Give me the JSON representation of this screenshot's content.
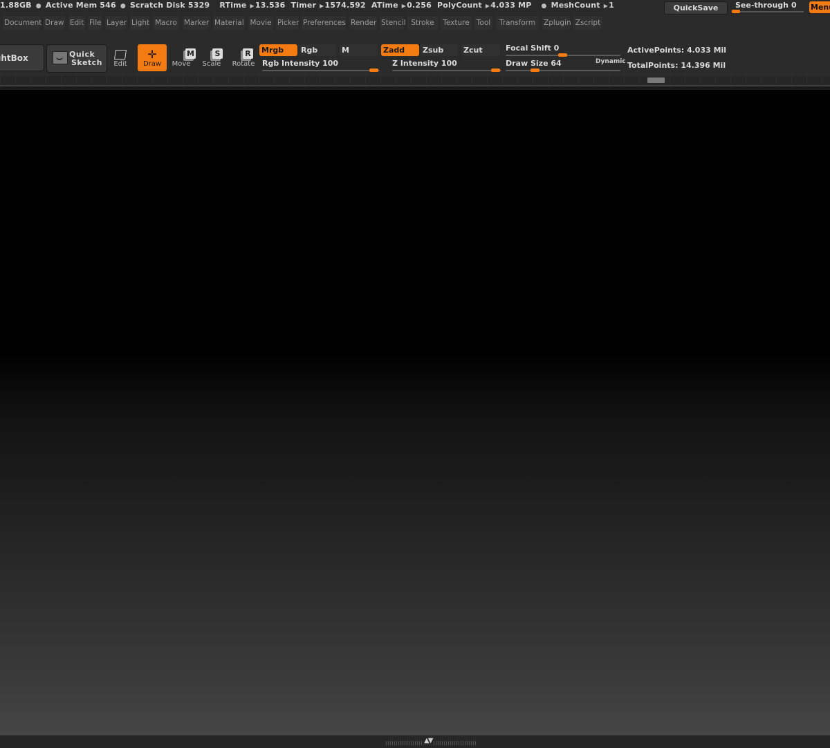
{
  "status": {
    "items": [
      {
        "text": "1.88GB"
      },
      {
        "text": "Active Mem 546"
      },
      {
        "text": "Scratch Disk 5329"
      },
      {
        "text": "RTime",
        "value": "13.536"
      },
      {
        "text": "Timer",
        "value": "1574.592"
      },
      {
        "text": "ATime",
        "value": "0.256"
      },
      {
        "text": "PolyCount",
        "value": "4.033  MP"
      },
      {
        "text": "MeshCount",
        "value": "1"
      }
    ],
    "quicksave_label": "QuickSave",
    "seethrough_label": "See-through",
    "seethrough_value": "0",
    "menus_label": "Menus"
  },
  "menubar": {
    "items": [
      "Document",
      "Draw",
      "Edit",
      "File",
      "Layer",
      "Light",
      "Macro",
      "Marker",
      "Material",
      "Movie",
      "Picker",
      "Preferences",
      "Render",
      "Stencil",
      "Stroke",
      "Texture",
      "Tool",
      "Transform",
      "Zplugin",
      "Zscript"
    ]
  },
  "toolbar": {
    "lightbox_label": "LightBox",
    "quicksketch_line1": "Quick",
    "quicksketch_line2": "Sketch",
    "tools": {
      "edit": "Edit",
      "draw": "Draw",
      "move": "Move",
      "scale": "Scale",
      "rotate": "Rotate"
    },
    "tool_icon_letters": {
      "move": "M",
      "scale": "S",
      "rotate": "R"
    },
    "active_tool": "draw",
    "color_modes": {
      "mrgb": "Mrgb",
      "rgb": "Rgb",
      "m": "M",
      "active": "mrgb"
    },
    "depth_modes": {
      "zadd": "Zadd",
      "zsub": "Zsub",
      "zcut": "Zcut",
      "active": "zadd"
    },
    "rgb_intensity": {
      "label": "Rgb  Intensity",
      "value": 100
    },
    "z_intensity": {
      "label": "Z  Intensity",
      "value": 100
    },
    "focal_shift": {
      "label": "Focal  Shift",
      "value": 0
    },
    "draw_size": {
      "label": "Draw  Size",
      "value": 64
    },
    "dynamic_label": "Dynamic",
    "active_points": {
      "label": "ActivePoints:",
      "value": "4.033  Mil"
    },
    "total_points": {
      "label": "TotalPoints:",
      "value": "14.396  Mil"
    }
  },
  "colors": {
    "accent": "#f47a12",
    "panel": "#2b2b2b",
    "canvas_top": "#000000",
    "canvas_bottom": "#464646"
  },
  "icons": [
    "edit-icon",
    "draw-icon",
    "move-icon",
    "scale-icon",
    "rotate-icon",
    "quick-sketch-icon",
    "up-down-arrows-icon"
  ]
}
